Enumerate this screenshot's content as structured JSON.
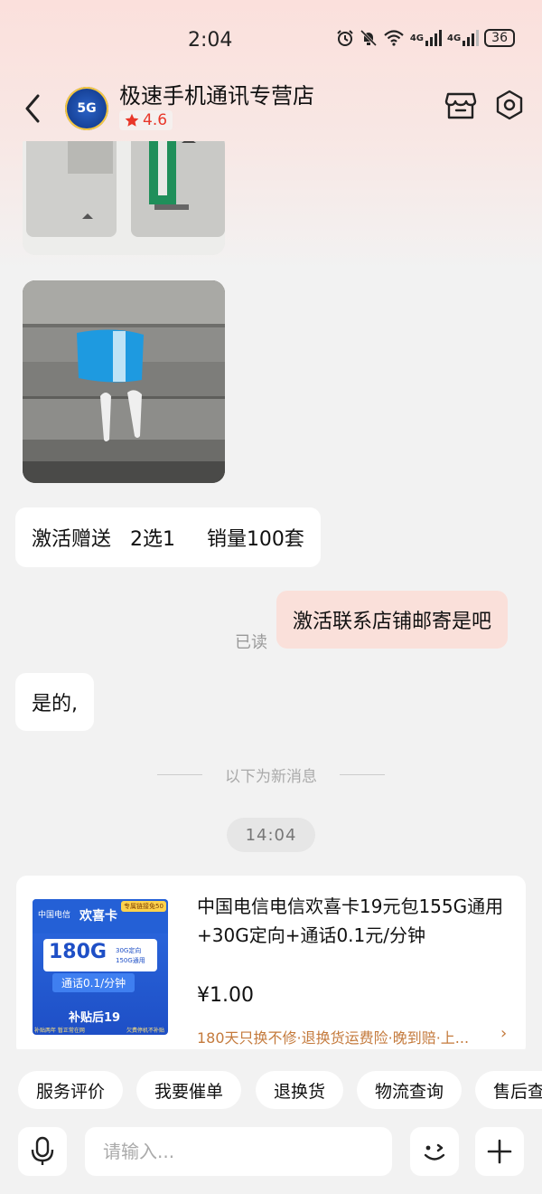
{
  "status_bar": {
    "time": "2:04",
    "network_1": "4G",
    "network_2": "4G",
    "battery": "36"
  },
  "header": {
    "shop_name": "极速手机通讯专营店",
    "rating": "4.6",
    "avatar_text": "5G"
  },
  "messages": {
    "text1": "激活赠送   2选1     销量100套",
    "text2": "激活联系店铺邮寄是吧",
    "read_label": "已读",
    "text3": "是的,"
  },
  "divider_text": "以下为新消息",
  "timestamp": "14:04",
  "product": {
    "title": "中国电信电信欢喜卡19元包155G通用+30G定向+通话0.1元/分钟",
    "price": "¥1.00",
    "service": "180天只换不修·退换货运费险·晚到赔·上...",
    "thumb": {
      "brand": "中国电信",
      "card_name": "欢喜卡",
      "tag": "专属链接免50",
      "data_big": "180G",
      "data_line1": "30G定向",
      "data_line2": "150G通用",
      "call": "通话0.1/分钟",
      "subsidy": "补贴后19",
      "foot_left": "补贴两年 暂正常在网",
      "foot_right": "欠费停机不补贴"
    }
  },
  "quick_actions": [
    "服务评价",
    "我要催单",
    "退换货",
    "物流查询",
    "售后查"
  ],
  "input": {
    "placeholder": "请输入..."
  }
}
